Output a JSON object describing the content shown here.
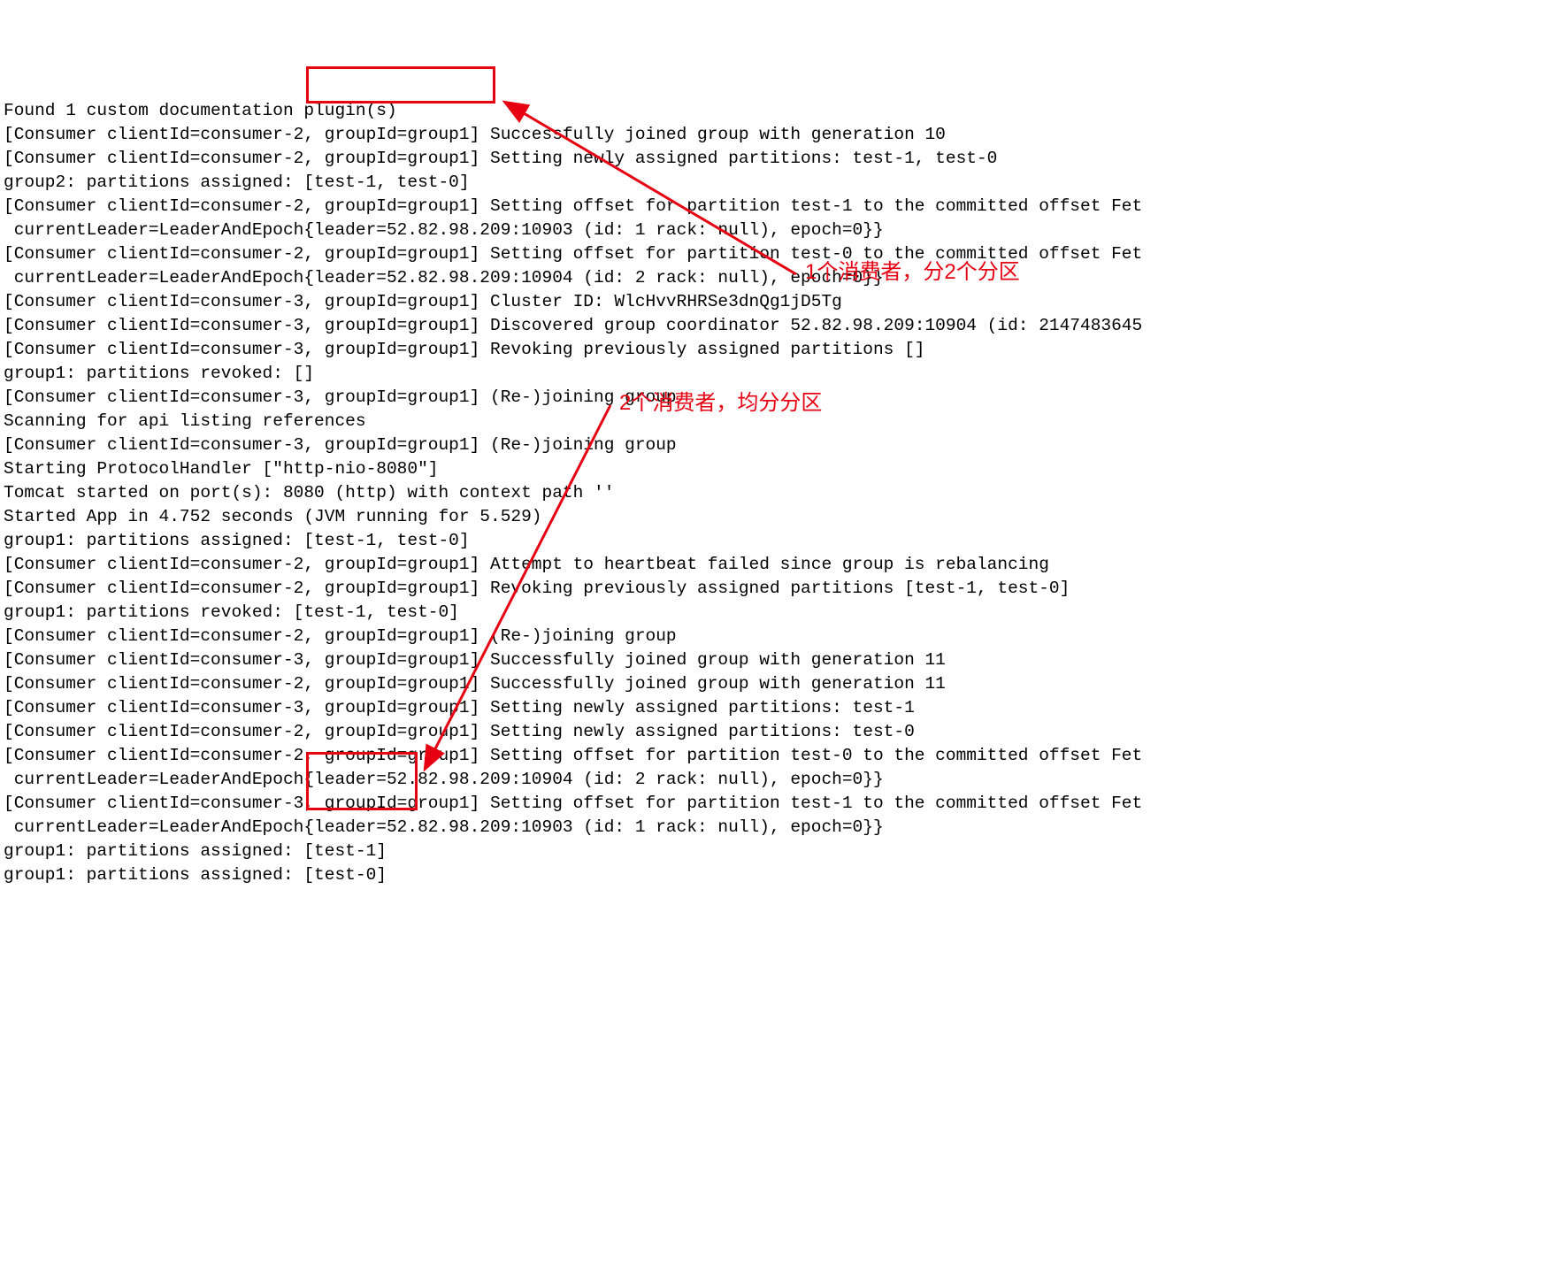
{
  "lines": [
    "Found 1 custom documentation plugin(s)",
    "[Consumer clientId=consumer-2, groupId=group1] Successfully joined group with generation 10",
    "[Consumer clientId=consumer-2, groupId=group1] Setting newly assigned partitions: test-1, test-0",
    "group2: partitions assigned: [test-1, test-0]",
    "[Consumer clientId=consumer-2, groupId=group1] Setting offset for partition test-1 to the committed offset Fet",
    " currentLeader=LeaderAndEpoch{leader=52.82.98.209:10903 (id: 1 rack: null), epoch=0}}",
    "[Consumer clientId=consumer-2, groupId=group1] Setting offset for partition test-0 to the committed offset Fet",
    " currentLeader=LeaderAndEpoch{leader=52.82.98.209:10904 (id: 2 rack: null), epoch=0}}",
    "[Consumer clientId=consumer-3, groupId=group1] Cluster ID: WlcHvvRHRSe3dnQg1jD5Tg",
    "[Consumer clientId=consumer-3, groupId=group1] Discovered group coordinator 52.82.98.209:10904 (id: 2147483645",
    "[Consumer clientId=consumer-3, groupId=group1] Revoking previously assigned partitions []",
    "group1: partitions revoked: []",
    "[Consumer clientId=consumer-3, groupId=group1] (Re-)joining group",
    "Scanning for api listing references",
    "[Consumer clientId=consumer-3, groupId=group1] (Re-)joining group",
    "Starting ProtocolHandler [\"http-nio-8080\"]",
    "Tomcat started on port(s): 8080 (http) with context path ''",
    "Started App in 4.752 seconds (JVM running for 5.529)",
    "group1: partitions assigned: [test-1, test-0]",
    "[Consumer clientId=consumer-2, groupId=group1] Attempt to heartbeat failed since group is rebalancing",
    "[Consumer clientId=consumer-2, groupId=group1] Revoking previously assigned partitions [test-1, test-0]",
    "group1: partitions revoked: [test-1, test-0]",
    "[Consumer clientId=consumer-2, groupId=group1] (Re-)joining group",
    "[Consumer clientId=consumer-3, groupId=group1] Successfully joined group with generation 11",
    "[Consumer clientId=consumer-2, groupId=group1] Successfully joined group with generation 11",
    "[Consumer clientId=consumer-3, groupId=group1] Setting newly assigned partitions: test-1",
    "[Consumer clientId=consumer-2, groupId=group1] Setting newly assigned partitions: test-0",
    "[Consumer clientId=consumer-2, groupId=group1] Setting offset for partition test-0 to the committed offset Fet",
    " currentLeader=LeaderAndEpoch{leader=52.82.98.209:10904 (id: 2 rack: null), epoch=0}}",
    "[Consumer clientId=consumer-3, groupId=group1] Setting offset for partition test-1 to the committed offset Fet",
    " currentLeader=LeaderAndEpoch{leader=52.82.98.209:10903 (id: 1 rack: null), epoch=0}}",
    "group1: partitions assigned: [test-1]",
    "group1: partitions assigned: [test-0]"
  ],
  "annotations": {
    "a1": "1个消费者，分2个分区",
    "a2": "2个消费者，均分分区"
  }
}
